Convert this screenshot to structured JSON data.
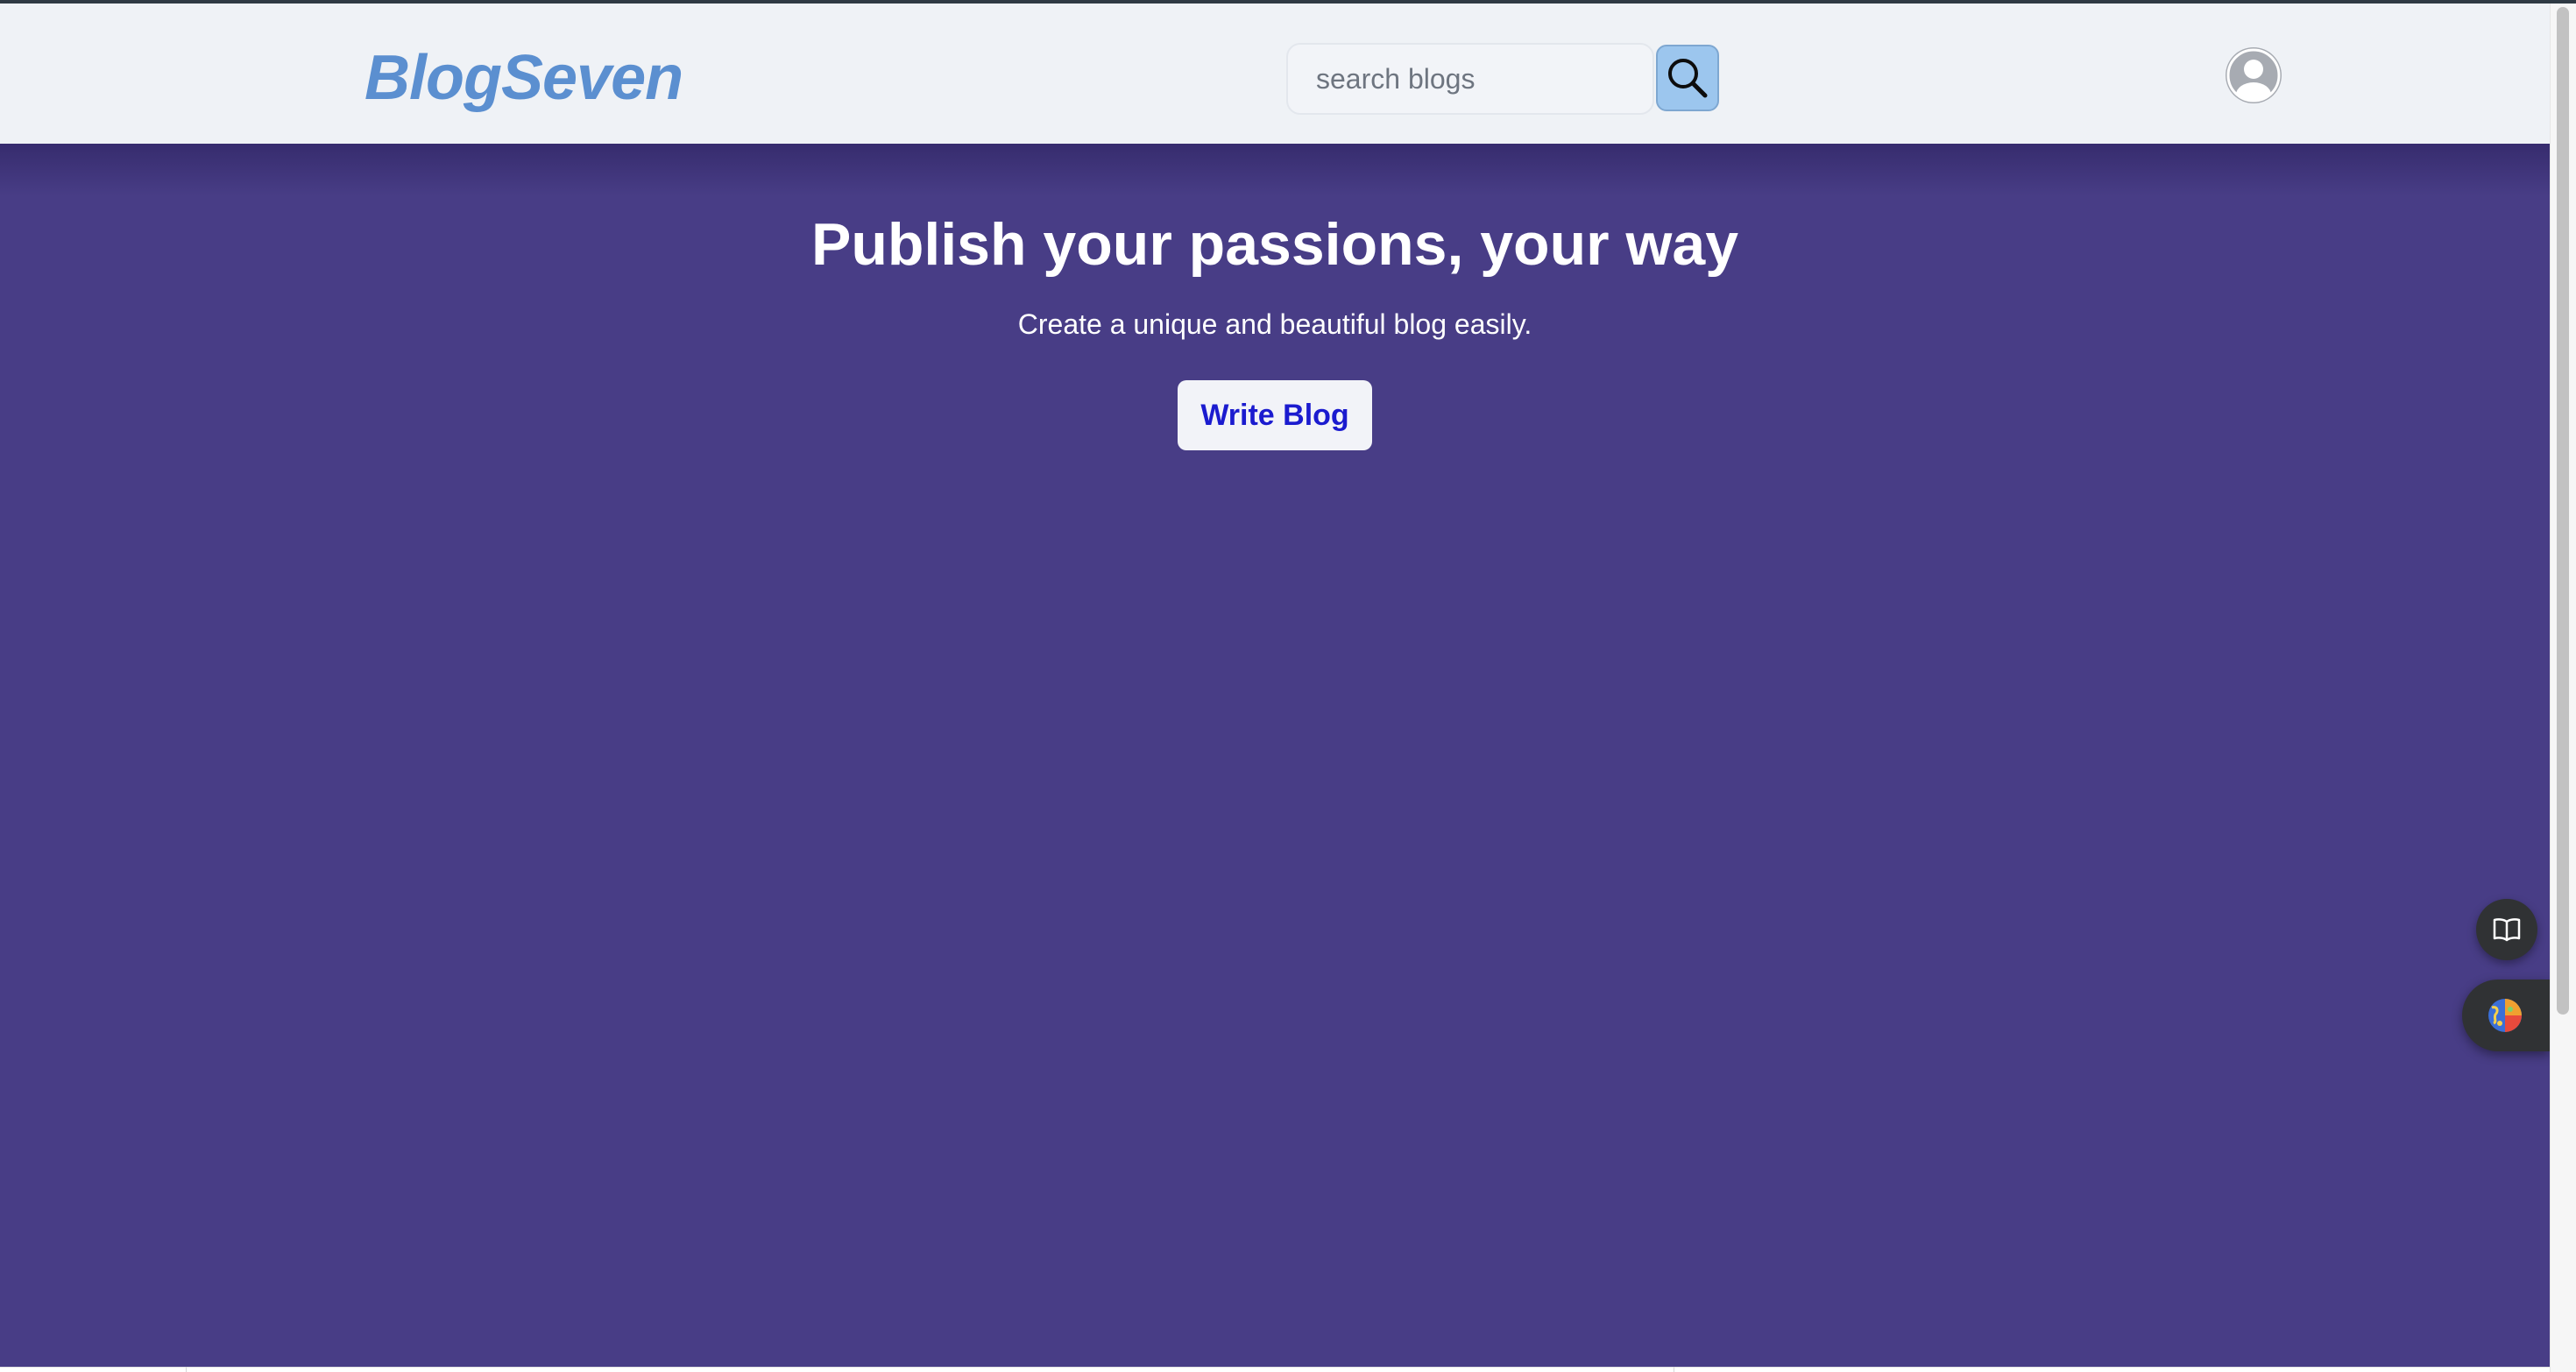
{
  "header": {
    "logo": "BlogSeven",
    "search": {
      "placeholder": "search blogs",
      "value": ""
    },
    "icons": {
      "search": "search-icon",
      "avatar": "user-avatar-icon"
    }
  },
  "hero": {
    "title": "Publish your passions, your way",
    "subtitle": "Create a unique and beautiful blog easily.",
    "cta_label": "Write Blog"
  },
  "floating": {
    "reader_icon": "open-book-icon",
    "extension_icon": "colorful-globe-icon"
  },
  "colors": {
    "hero_background": "#483d86",
    "header_background": "#eff2f6",
    "logo": "#5b8fd0",
    "cta_text": "#1b1bcf",
    "search_button": "#9cc6ee"
  }
}
